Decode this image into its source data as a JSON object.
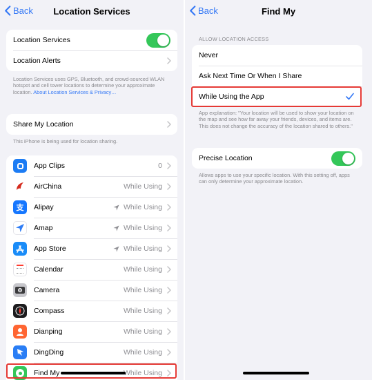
{
  "left": {
    "nav": {
      "back_label": "Back",
      "title": "Location Services"
    },
    "group1": {
      "location_services": "Location Services",
      "location_alerts": "Location Alerts"
    },
    "footer1": {
      "text": "Location Services uses GPS, Bluetooth, and crowd-sourced WLAN hotspot and cell tower locations to determine your approximate location.",
      "link": "About Location Services & Privacy…"
    },
    "share": {
      "label": "Share My Location",
      "footer": "This iPhone is being used for location sharing."
    },
    "apps": [
      {
        "name": "App Clips",
        "value": "0",
        "arrow": false,
        "icon": "app-clips-icon"
      },
      {
        "name": "AirChina",
        "value": "While Using",
        "arrow": false,
        "icon": "airchina-icon"
      },
      {
        "name": "Alipay",
        "value": "While Using",
        "arrow": true,
        "icon": "alipay-icon"
      },
      {
        "name": "Amap",
        "value": "While Using",
        "arrow": true,
        "icon": "amap-icon"
      },
      {
        "name": "App Store",
        "value": "While Using",
        "arrow": true,
        "icon": "app-store-icon"
      },
      {
        "name": "Calendar",
        "value": "While Using",
        "arrow": false,
        "icon": "calendar-icon"
      },
      {
        "name": "Camera",
        "value": "While Using",
        "arrow": false,
        "icon": "camera-icon"
      },
      {
        "name": "Compass",
        "value": "While Using",
        "arrow": false,
        "icon": "compass-icon"
      },
      {
        "name": "Dianping",
        "value": "While Using",
        "arrow": false,
        "icon": "dianping-icon"
      },
      {
        "name": "DingDing",
        "value": "While Using",
        "arrow": false,
        "icon": "dingding-icon"
      },
      {
        "name": "Find My",
        "value": "While Using",
        "arrow": false,
        "icon": "find-my-icon"
      }
    ]
  },
  "right": {
    "nav": {
      "back_label": "Back",
      "title": "Find My"
    },
    "section_header": "ALLOW LOCATION ACCESS",
    "options": {
      "never": "Never",
      "ask": "Ask Next Time Or When I Share",
      "while_using": "While Using the App"
    },
    "selected_option": "While Using the App",
    "explanation": "App explanation: \"Your location will be used to show your location on the map and see how far away your friends, devices, and items are. This does not change the accuracy of the location shared to others.\"",
    "precise": {
      "label": "Precise Location",
      "enabled": true,
      "footer": "Allows apps to use your specific location. With this setting off, apps can only determine your approximate location."
    }
  },
  "colors": {
    "accent": "#3478f6",
    "toggle_on": "#34c759",
    "highlight": "#e53935",
    "background": "#f2f2f7",
    "secondary_text": "#8e8e93"
  }
}
